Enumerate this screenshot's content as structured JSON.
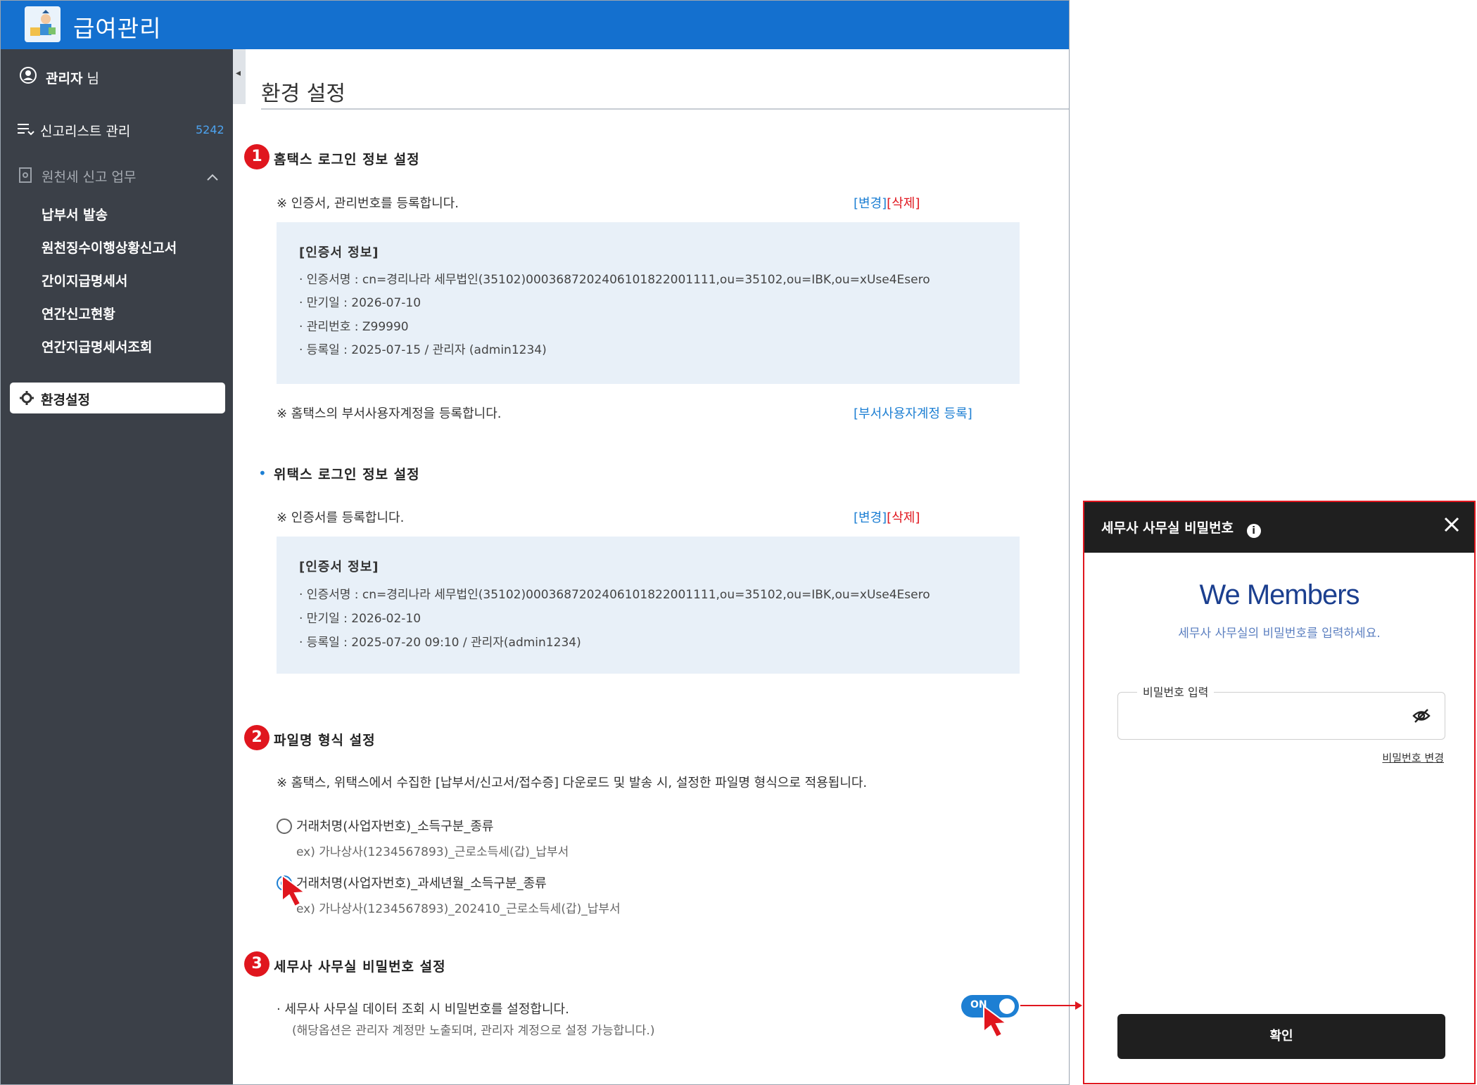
{
  "app": {
    "title": "급여관리"
  },
  "sidebar": {
    "user_name": "관리자",
    "user_suffix": "님",
    "report_list": {
      "label": "신고리스트 관리",
      "count": "5242"
    },
    "withholding": {
      "label": "원천세 신고 업무",
      "items": [
        {
          "label": "납부서 발송"
        },
        {
          "label": "원천징수이행상황신고서"
        },
        {
          "label": "간이지급명세서"
        },
        {
          "label": "연간신고현황"
        },
        {
          "label": "연간지급명세서조회"
        }
      ]
    },
    "settings": {
      "label": "환경설정"
    }
  },
  "main": {
    "page_title": "환경 설정",
    "hometax": {
      "badge": "1",
      "title": "홈택스 로그인 정보 설정",
      "note": "※ 인증서, 관리번호를 등록합니다.",
      "change_link": "[변경]",
      "delete_link": "[삭제]",
      "cert": {
        "heading": "[인증서 정보]",
        "name": "· 인증서명 : cn=경리나라 세무법인(35102)000368720240610182200111​1,ou=35102,ou=IBK,ou=xUse4Esero",
        "expiry": "· 만기일 : 2026-07-10",
        "mgmt_no": "· 관리번호 : Z99990",
        "registered": "· 등록일 : 2025-07-15 / 관리자 (admin1234)"
      },
      "dept_note": "※ 홈택스의 부서사용자계정을 등록합니다.",
      "dept_link": "[부서사용자계정 등록]"
    },
    "wetax": {
      "bullet": "•",
      "title": "위택스 로그인 정보 설정",
      "note": "※ 인증서를 등록합니다.",
      "change_link": "[변경]",
      "delete_link": "[삭제]",
      "cert": {
        "heading": "[인증서 정보]",
        "name": "· 인증서명 : cn=경리나라 세무법인(35102)000368720240610182200111​1,ou=35102,ou=IBK,ou=xUse4Esero",
        "expiry": "· 만기일    : 2026-02-10",
        "registered": "· 등록일    : 2025-07-20 09:10 / 관리자(admin1234)"
      }
    },
    "filename": {
      "badge": "2",
      "title": "파일명 형식 설정",
      "note": "※ 홈택스, 위택스에서 수집한 [납부서/신고서/접수증] 다운로드 및 발송 시, 설정한 파일명 형식으로 적용됩니다.",
      "options": [
        {
          "label": "거래처명(사업자번호)_소득구분_종류",
          "example": "ex) 가나상사(1234567893)_근로소득세(갑)_납부서",
          "checked": false
        },
        {
          "label": "거래처명(사업자번호)_과세년월_소득구분_종류",
          "example": "ex) 가나상사(1234567893)_202410_근로소득세(갑)_납부서",
          "checked": true
        }
      ]
    },
    "password": {
      "badge": "3",
      "title": "세무사 사무실 비밀번호 설정",
      "note": "· 세무사 사무실 데이터 조회 시 비밀번호를 설정합니다.",
      "subnote": "(해당옵션은 관리자 계정만 노출되며, 관리자 계정으로 설정 가능합니다.)",
      "toggle_label": "ON",
      "toggle_on": true
    }
  },
  "modal": {
    "title": "세무사 사무실 비밀번호",
    "brand": "We Members",
    "subtitle": "세무사 사무실의 비밀번호를 입력하세요.",
    "field_label": "비밀번호 입력",
    "field_value": "",
    "change_link": "비밀번호 변경",
    "confirm_label": "확인"
  },
  "colors": {
    "topbar": "#1470cf",
    "sidebar": "#3b4048",
    "accent_red": "#e0161e",
    "link_blue": "#1d7fd3",
    "info_box": "#e8f0f8",
    "modal_header": "#1f1f1f",
    "brand_navy": "#1b3f8f"
  },
  "icons": [
    "payroll-logo-icon",
    "user-circle-icon",
    "list-icon",
    "document-search-icon",
    "chevron-up-icon",
    "gear-icon",
    "chevron-left-icon",
    "info-icon",
    "close-icon",
    "eye-off-icon",
    "cursor-arrow-icon"
  ]
}
